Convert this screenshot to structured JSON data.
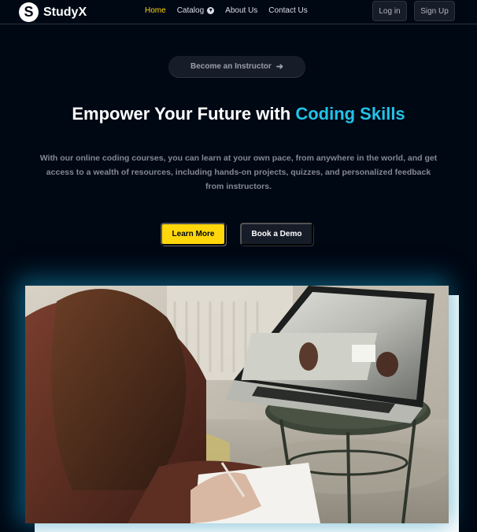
{
  "brand": {
    "logo_letter": "S",
    "name": "StudyX"
  },
  "nav": {
    "links": [
      {
        "label": "Home",
        "active": true
      },
      {
        "label": "Catalog",
        "has_dropdown": true
      },
      {
        "label": "About Us"
      },
      {
        "label": "Contact Us"
      }
    ],
    "login_label": "Log in",
    "signup_label": "Sign Up"
  },
  "hero": {
    "pill_label": "Become an Instructor",
    "title_plain": "Empower Your Future with ",
    "title_highlight": "Coding Skills",
    "description": "With our online coding courses, you can learn at your own pace, from anywhere in the world, and get access to a wealth of resources, including hands-on projects, quizzes, and personalized feedback from instructors.",
    "cta_primary": "Learn More",
    "cta_secondary": "Book a Demo"
  },
  "colors": {
    "background": "#000814",
    "accent_yellow": "#ffd60a",
    "highlight_cyan": "#22c3e8",
    "video_glow": "#118ab2"
  },
  "icons": {
    "logo": "logo-s-icon",
    "catalog_dropdown": "chevron-down-icon",
    "pill_arrow": "arrow-right-icon"
  }
}
